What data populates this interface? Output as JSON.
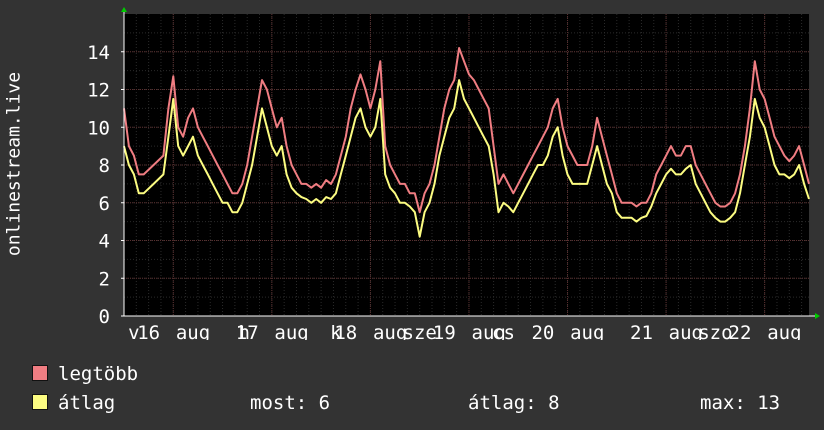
{
  "chart_data": {
    "type": "line",
    "ylabel": "onlinestream.live",
    "ylim": [
      0,
      16
    ],
    "yticks": [
      0,
      2,
      4,
      6,
      8,
      10,
      12,
      14
    ],
    "grid": true,
    "xticks": [
      {
        "t": 0.1,
        "label": "v"
      },
      {
        "t": 0.25,
        "label": "16"
      },
      {
        "t": 0.7,
        "label": "aug"
      },
      {
        "t": 1.22,
        "label": "h"
      },
      {
        "t": 1.25,
        "label": "17"
      },
      {
        "t": 1.7,
        "label": "aug"
      },
      {
        "t": 2.15,
        "label": "k"
      },
      {
        "t": 2.25,
        "label": "18"
      },
      {
        "t": 2.7,
        "label": "aug"
      },
      {
        "t": 3.0,
        "label": "sze"
      },
      {
        "t": 3.25,
        "label": "19"
      },
      {
        "t": 3.7,
        "label": "aug"
      },
      {
        "t": 3.85,
        "label": "cs"
      },
      {
        "t": 4.25,
        "label": "20"
      },
      {
        "t": 4.7,
        "label": "aug"
      },
      {
        "t": 5.25,
        "label": "21"
      },
      {
        "t": 5.7,
        "label": "aug"
      },
      {
        "t": 6.0,
        "label": "szo"
      },
      {
        "t": 6.25,
        "label": "22"
      },
      {
        "t": 6.7,
        "label": "aug"
      }
    ],
    "series": [
      {
        "name": "legtöbb",
        "color": "#f07d82",
        "points": [
          [
            0.0,
            11
          ],
          [
            0.05,
            9
          ],
          [
            0.1,
            8.5
          ],
          [
            0.15,
            7.5
          ],
          [
            0.2,
            7.5
          ],
          [
            0.3,
            8
          ],
          [
            0.4,
            8.5
          ],
          [
            0.45,
            11
          ],
          [
            0.5,
            12.7
          ],
          [
            0.55,
            10
          ],
          [
            0.6,
            9.5
          ],
          [
            0.65,
            10.5
          ],
          [
            0.7,
            11
          ],
          [
            0.75,
            10
          ],
          [
            0.8,
            9.5
          ],
          [
            0.85,
            9
          ],
          [
            0.9,
            8.5
          ],
          [
            0.95,
            8
          ],
          [
            1.0,
            7.5
          ],
          [
            1.05,
            7
          ],
          [
            1.1,
            6.5
          ],
          [
            1.15,
            6.5
          ],
          [
            1.2,
            7
          ],
          [
            1.25,
            8
          ],
          [
            1.3,
            9.5
          ],
          [
            1.35,
            11
          ],
          [
            1.4,
            12.5
          ],
          [
            1.45,
            12
          ],
          [
            1.5,
            11
          ],
          [
            1.55,
            10
          ],
          [
            1.6,
            10.5
          ],
          [
            1.65,
            9
          ],
          [
            1.7,
            8
          ],
          [
            1.75,
            7.5
          ],
          [
            1.8,
            7
          ],
          [
            1.85,
            7
          ],
          [
            1.9,
            6.8
          ],
          [
            1.95,
            7
          ],
          [
            2.0,
            6.8
          ],
          [
            2.05,
            7.2
          ],
          [
            2.1,
            7
          ],
          [
            2.15,
            7.5
          ],
          [
            2.2,
            8.5
          ],
          [
            2.25,
            9.5
          ],
          [
            2.3,
            11
          ],
          [
            2.35,
            12
          ],
          [
            2.4,
            12.8
          ],
          [
            2.45,
            12
          ],
          [
            2.5,
            11
          ],
          [
            2.55,
            12
          ],
          [
            2.6,
            13.5
          ],
          [
            2.65,
            9
          ],
          [
            2.7,
            8
          ],
          [
            2.75,
            7.5
          ],
          [
            2.8,
            7
          ],
          [
            2.85,
            7
          ],
          [
            2.9,
            6.5
          ],
          [
            2.95,
            6.5
          ],
          [
            3.0,
            5.5
          ],
          [
            3.05,
            6.5
          ],
          [
            3.1,
            7
          ],
          [
            3.15,
            8
          ],
          [
            3.2,
            9.5
          ],
          [
            3.25,
            11
          ],
          [
            3.3,
            12
          ],
          [
            3.35,
            12.5
          ],
          [
            3.4,
            14.2
          ],
          [
            3.45,
            13.5
          ],
          [
            3.5,
            12.8
          ],
          [
            3.55,
            12.5
          ],
          [
            3.6,
            12
          ],
          [
            3.65,
            11.5
          ],
          [
            3.7,
            11
          ],
          [
            3.75,
            9
          ],
          [
            3.8,
            7
          ],
          [
            3.85,
            7.5
          ],
          [
            3.9,
            7
          ],
          [
            3.95,
            6.5
          ],
          [
            4.0,
            7
          ],
          [
            4.05,
            7.5
          ],
          [
            4.1,
            8
          ],
          [
            4.15,
            8.5
          ],
          [
            4.2,
            9
          ],
          [
            4.25,
            9.5
          ],
          [
            4.3,
            10
          ],
          [
            4.35,
            11
          ],
          [
            4.4,
            11.5
          ],
          [
            4.45,
            10
          ],
          [
            4.5,
            9
          ],
          [
            4.55,
            8.5
          ],
          [
            4.6,
            8
          ],
          [
            4.65,
            8
          ],
          [
            4.7,
            8
          ],
          [
            4.75,
            9
          ],
          [
            4.8,
            10.5
          ],
          [
            4.85,
            9.5
          ],
          [
            4.9,
            8.5
          ],
          [
            4.95,
            7.5
          ],
          [
            5.0,
            6.5
          ],
          [
            5.05,
            6
          ],
          [
            5.1,
            6
          ],
          [
            5.15,
            6
          ],
          [
            5.2,
            5.8
          ],
          [
            5.25,
            6
          ],
          [
            5.3,
            6
          ],
          [
            5.35,
            6.5
          ],
          [
            5.4,
            7.5
          ],
          [
            5.45,
            8
          ],
          [
            5.5,
            8.5
          ],
          [
            5.55,
            9
          ],
          [
            5.6,
            8.5
          ],
          [
            5.65,
            8.5
          ],
          [
            5.7,
            9
          ],
          [
            5.75,
            9
          ],
          [
            5.8,
            8
          ],
          [
            5.85,
            7.5
          ],
          [
            5.9,
            7
          ],
          [
            5.95,
            6.5
          ],
          [
            6.0,
            6
          ],
          [
            6.05,
            5.8
          ],
          [
            6.1,
            5.8
          ],
          [
            6.15,
            6
          ],
          [
            6.2,
            6.5
          ],
          [
            6.25,
            7.5
          ],
          [
            6.3,
            9
          ],
          [
            6.35,
            11
          ],
          [
            6.4,
            13.5
          ],
          [
            6.45,
            12
          ],
          [
            6.5,
            11.5
          ],
          [
            6.55,
            10.5
          ],
          [
            6.6,
            9.5
          ],
          [
            6.65,
            9
          ],
          [
            6.7,
            8.5
          ],
          [
            6.75,
            8.2
          ],
          [
            6.8,
            8.5
          ],
          [
            6.85,
            9
          ],
          [
            6.9,
            8
          ],
          [
            6.95,
            7
          ]
        ]
      },
      {
        "name": "átlag",
        "color": "#fcfc81",
        "points": [
          [
            0.0,
            9
          ],
          [
            0.05,
            8
          ],
          [
            0.1,
            7.5
          ],
          [
            0.15,
            6.5
          ],
          [
            0.2,
            6.5
          ],
          [
            0.3,
            7
          ],
          [
            0.4,
            7.5
          ],
          [
            0.45,
            9.5
          ],
          [
            0.5,
            11.5
          ],
          [
            0.55,
            9
          ],
          [
            0.6,
            8.5
          ],
          [
            0.65,
            9
          ],
          [
            0.7,
            9.5
          ],
          [
            0.75,
            8.5
          ],
          [
            0.8,
            8
          ],
          [
            0.85,
            7.5
          ],
          [
            0.9,
            7
          ],
          [
            0.95,
            6.5
          ],
          [
            1.0,
            6
          ],
          [
            1.05,
            6
          ],
          [
            1.1,
            5.5
          ],
          [
            1.15,
            5.5
          ],
          [
            1.2,
            6
          ],
          [
            1.25,
            7
          ],
          [
            1.3,
            8
          ],
          [
            1.35,
            9.5
          ],
          [
            1.4,
            11
          ],
          [
            1.45,
            10
          ],
          [
            1.5,
            9
          ],
          [
            1.55,
            8.5
          ],
          [
            1.6,
            9
          ],
          [
            1.65,
            7.5
          ],
          [
            1.7,
            6.8
          ],
          [
            1.75,
            6.5
          ],
          [
            1.8,
            6.3
          ],
          [
            1.85,
            6.2
          ],
          [
            1.9,
            6
          ],
          [
            1.95,
            6.2
          ],
          [
            2.0,
            6
          ],
          [
            2.05,
            6.3
          ],
          [
            2.1,
            6.2
          ],
          [
            2.15,
            6.5
          ],
          [
            2.2,
            7.5
          ],
          [
            2.25,
            8.5
          ],
          [
            2.3,
            9.5
          ],
          [
            2.35,
            10.5
          ],
          [
            2.4,
            11
          ],
          [
            2.45,
            10
          ],
          [
            2.5,
            9.5
          ],
          [
            2.55,
            10
          ],
          [
            2.6,
            11.5
          ],
          [
            2.65,
            7.5
          ],
          [
            2.7,
            6.8
          ],
          [
            2.75,
            6.5
          ],
          [
            2.8,
            6
          ],
          [
            2.85,
            6
          ],
          [
            2.9,
            5.8
          ],
          [
            2.95,
            5.5
          ],
          [
            3.0,
            4.2
          ],
          [
            3.05,
            5.5
          ],
          [
            3.1,
            6
          ],
          [
            3.15,
            7
          ],
          [
            3.2,
            8.5
          ],
          [
            3.25,
            9.5
          ],
          [
            3.3,
            10.5
          ],
          [
            3.35,
            11
          ],
          [
            3.4,
            12.5
          ],
          [
            3.45,
            11.5
          ],
          [
            3.5,
            11
          ],
          [
            3.55,
            10.5
          ],
          [
            3.6,
            10
          ],
          [
            3.65,
            9.5
          ],
          [
            3.7,
            9
          ],
          [
            3.75,
            7.5
          ],
          [
            3.8,
            5.5
          ],
          [
            3.85,
            6
          ],
          [
            3.9,
            5.8
          ],
          [
            3.95,
            5.5
          ],
          [
            4.0,
            6
          ],
          [
            4.05,
            6.5
          ],
          [
            4.1,
            7
          ],
          [
            4.15,
            7.5
          ],
          [
            4.2,
            8
          ],
          [
            4.25,
            8
          ],
          [
            4.3,
            8.5
          ],
          [
            4.35,
            9.5
          ],
          [
            4.4,
            10
          ],
          [
            4.45,
            8.5
          ],
          [
            4.5,
            7.5
          ],
          [
            4.55,
            7
          ],
          [
            4.6,
            7
          ],
          [
            4.65,
            7
          ],
          [
            4.7,
            7
          ],
          [
            4.75,
            8
          ],
          [
            4.8,
            9
          ],
          [
            4.85,
            8
          ],
          [
            4.9,
            7
          ],
          [
            4.95,
            6.5
          ],
          [
            5.0,
            5.5
          ],
          [
            5.05,
            5.2
          ],
          [
            5.1,
            5.2
          ],
          [
            5.15,
            5.2
          ],
          [
            5.2,
            5
          ],
          [
            5.25,
            5.2
          ],
          [
            5.3,
            5.3
          ],
          [
            5.35,
            5.8
          ],
          [
            5.4,
            6.5
          ],
          [
            5.45,
            7
          ],
          [
            5.5,
            7.5
          ],
          [
            5.55,
            7.8
          ],
          [
            5.6,
            7.5
          ],
          [
            5.65,
            7.5
          ],
          [
            5.7,
            7.8
          ],
          [
            5.75,
            8
          ],
          [
            5.8,
            7
          ],
          [
            5.85,
            6.5
          ],
          [
            5.9,
            6
          ],
          [
            5.95,
            5.5
          ],
          [
            6.0,
            5.2
          ],
          [
            6.05,
            5
          ],
          [
            6.1,
            5
          ],
          [
            6.15,
            5.2
          ],
          [
            6.2,
            5.5
          ],
          [
            6.25,
            6.5
          ],
          [
            6.3,
            8
          ],
          [
            6.35,
            9.5
          ],
          [
            6.4,
            11.5
          ],
          [
            6.45,
            10.5
          ],
          [
            6.5,
            10
          ],
          [
            6.55,
            9
          ],
          [
            6.6,
            8
          ],
          [
            6.65,
            7.5
          ],
          [
            6.7,
            7.5
          ],
          [
            6.75,
            7.3
          ],
          [
            6.8,
            7.5
          ],
          [
            6.85,
            8
          ],
          [
            6.9,
            7
          ],
          [
            6.95,
            6.2
          ]
        ]
      }
    ],
    "legend": [
      {
        "label": "legtöbb",
        "color": "#f07d82"
      },
      {
        "label": "átlag",
        "color": "#fcfc81"
      }
    ],
    "stats": {
      "now": "most: 6",
      "avg": "átlag: 8",
      "max": "max: 13"
    }
  },
  "colors": {
    "background": "#333333",
    "plot_background": "#000000",
    "grid_minor": "#2a2a2a",
    "grid_major": "#5a2f2f",
    "axis": "#ffffff",
    "arrow": "#00cc00"
  }
}
